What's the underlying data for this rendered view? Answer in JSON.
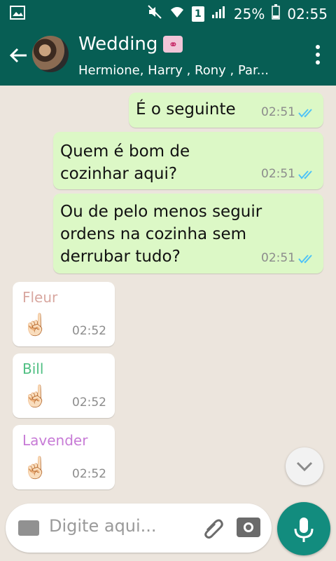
{
  "status_bar": {
    "battery": "25%",
    "time": "02:55",
    "sim": "1"
  },
  "header": {
    "title": "Wedding",
    "subtitle": "Hermione, Harry , Rony , Par..."
  },
  "messages": [
    {
      "type": "outgoing",
      "text": "É o seguinte",
      "time": "02:51"
    },
    {
      "type": "outgoing",
      "text": "Quem é bom de cozinhar aqui?",
      "time": "02:51"
    },
    {
      "type": "outgoing",
      "text": "Ou de pelo menos seguir ordens na cozinha sem derrubar tudo?",
      "time": "02:51"
    },
    {
      "type": "incoming",
      "sender": "Fleur",
      "sender_color": "#d8a7a0",
      "text": "☝🏻",
      "time": "02:52"
    },
    {
      "type": "incoming",
      "sender": "Bill",
      "sender_color": "#4fbf82",
      "text": "☝🏻",
      "time": "02:52"
    },
    {
      "type": "incoming",
      "sender": "Lavender",
      "sender_color": "#c77bd6",
      "text": "☝🏻",
      "time": "02:52"
    }
  ],
  "composer": {
    "placeholder": "Digite aqui..."
  },
  "colors": {
    "brand": "#075e54",
    "accent": "#128c7e",
    "outgoing": "#dcf8c6",
    "tick_read": "#4fc3f7"
  },
  "icons": {
    "back": "arrow-left-icon",
    "menu": "more-vert-icon",
    "mic": "mic-icon",
    "camera": "camera-icon",
    "attach": "paperclip-icon",
    "keyboard": "keyboard-icon",
    "scroll": "chevron-down-icon"
  }
}
